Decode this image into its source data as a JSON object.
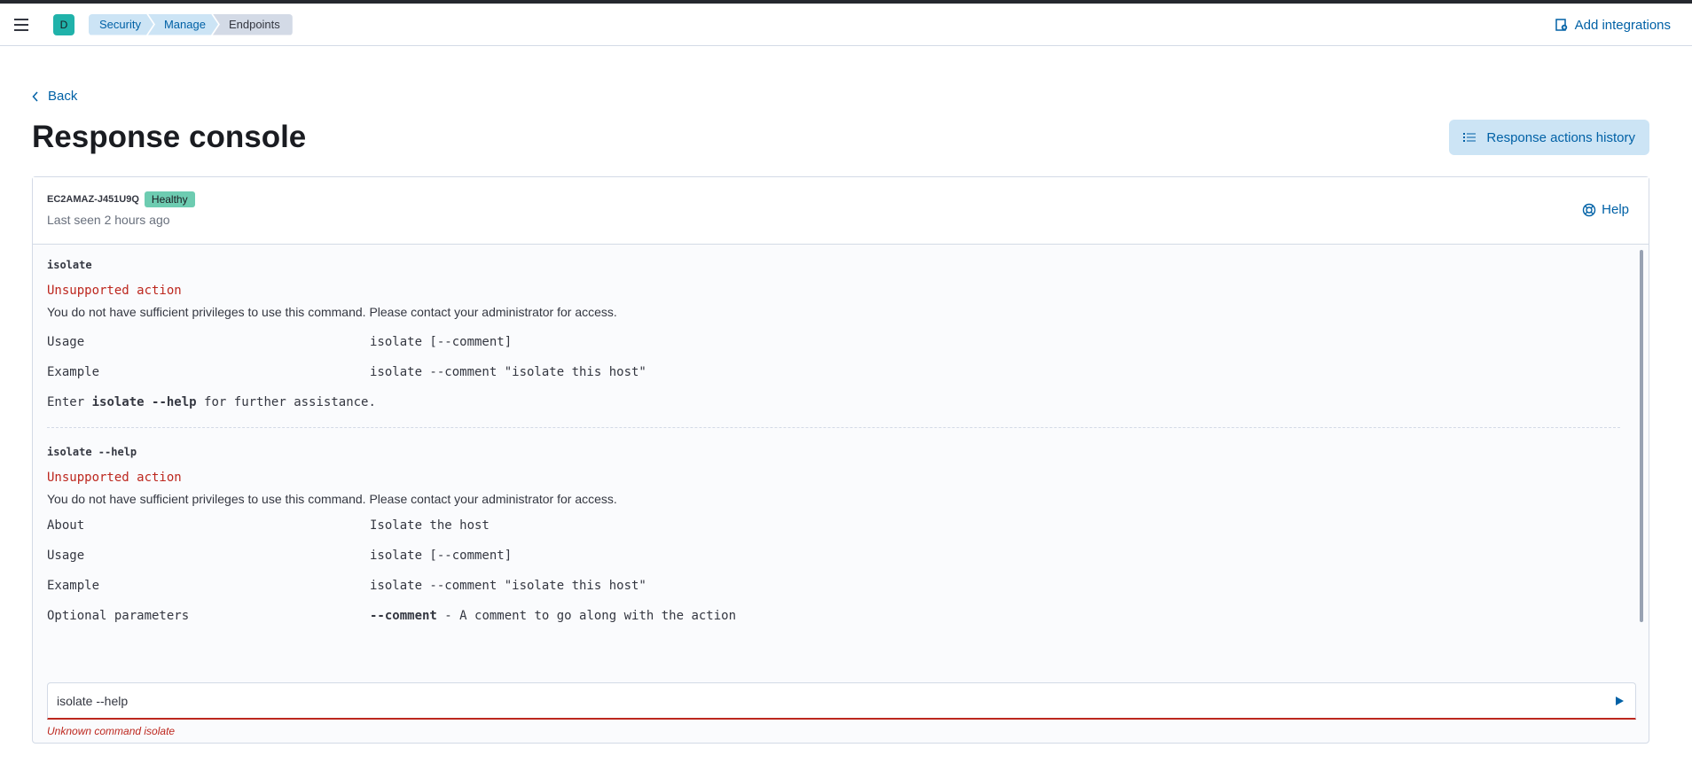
{
  "header": {
    "avatar_letter": "D",
    "breadcrumbs": [
      "Security",
      "Manage",
      "Endpoints"
    ],
    "add_integrations": "Add integrations"
  },
  "page": {
    "back_label": "Back",
    "title": "Response console",
    "history_button": "Response actions history"
  },
  "console": {
    "host_name": "EC2AMAZ-J451U9Q",
    "status": "Healthy",
    "last_seen": "Last seen 2 hours ago",
    "help_label": "Help",
    "entries": [
      {
        "command": "isolate",
        "error_title": "Unsupported action",
        "error_message": "You do not have sufficient privileges to use this command. Please contact your administrator for access.",
        "usage_label": "Usage",
        "usage_value": "isolate [--comment]",
        "example_label": "Example",
        "example_value": "isolate --comment \"isolate this host\"",
        "hint_prefix": "Enter",
        "hint_cmd": "isolate --help",
        "hint_suffix": "for further assistance."
      },
      {
        "command": "isolate --help",
        "error_title": "Unsupported action",
        "error_message": "You do not have sufficient privileges to use this command. Please contact your administrator for access.",
        "about_label": "About",
        "about_value": "Isolate the host",
        "usage_label": "Usage",
        "usage_value": "isolate [--comment]",
        "example_label": "Example",
        "example_value": "isolate --comment \"isolate this host\"",
        "optional_label": "Optional parameters",
        "optional_param": "--comment",
        "optional_desc": "- A comment to go along with the action"
      }
    ],
    "input_value": "isolate --help",
    "input_error": "Unknown command isolate"
  },
  "colors": {
    "accent": "#0061a6",
    "error": "#bd271e",
    "healthy": "#6dccb1"
  }
}
